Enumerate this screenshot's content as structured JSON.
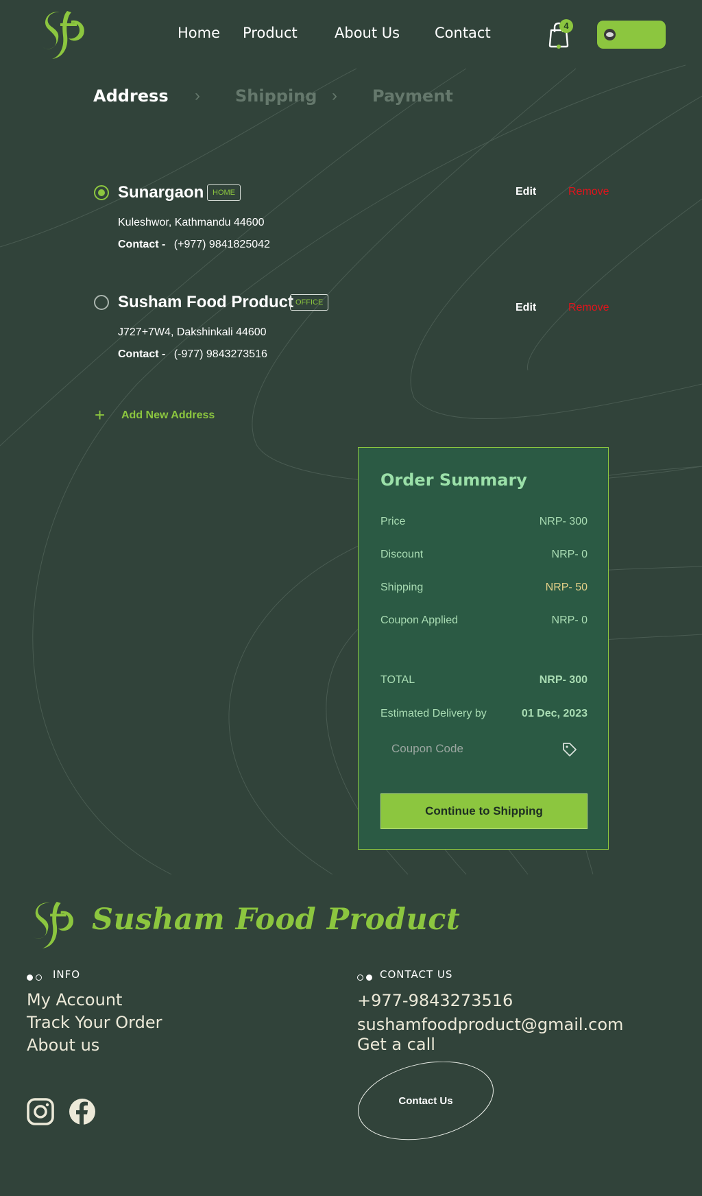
{
  "header": {
    "nav": [
      "Home",
      "Product",
      "About Us",
      "Contact"
    ],
    "cart_count": "4",
    "icons": {
      "logo": "sfp-monogram-logo",
      "cart": "shopping-bag-icon",
      "avatar": "user-avatar"
    }
  },
  "steps": {
    "address": "Address",
    "shipping": "Shipping",
    "payment": "Payment",
    "separator": "›"
  },
  "addresses": [
    {
      "name": "Sunargaon",
      "tag": "HOME",
      "line": "Kuleshwor, Kathmandu 44600",
      "contact_label": "Contact -",
      "phone": "(+977) 9841825042",
      "selected": true
    },
    {
      "name": "Susham Food Product",
      "tag": "OFFICE",
      "line": "J727+7W4, Dakshinkali 44600",
      "contact_label": "Contact -",
      "phone": "(-977) 9843273516",
      "selected": false
    }
  ],
  "actions": {
    "edit": "Edit",
    "remove": "Remove",
    "add_new": "Add New Address"
  },
  "summary": {
    "title": "Order Summary",
    "rows": [
      {
        "label": "Price",
        "value": "NRP- 300"
      },
      {
        "label": "Discount",
        "value": "NRP- 0"
      },
      {
        "label": "Shipping",
        "value": "NRP- 50"
      },
      {
        "label": "Coupon Applied",
        "value": "NRP- 0"
      }
    ],
    "total_label": "TOTAL",
    "total_value": "NRP- 300",
    "delivery_label": "Estimated Delivery by",
    "delivery_value": "01 Dec, 2023",
    "coupon_placeholder": "Coupon Code",
    "cta": "Continue to Shipping"
  },
  "footer": {
    "brand": "Susham Food Product",
    "info_heading": "INFO",
    "info_links": [
      "My Account",
      "Track Your Order",
      "About us"
    ],
    "contact_heading": "CONTACT US",
    "phone": "+977-9843273516",
    "email": "sushamfoodproduct@gmail.com",
    "call": "Get a call",
    "contact_button": "Contact Us",
    "social": [
      "instagram-icon",
      "facebook-icon"
    ]
  },
  "colors": {
    "background": "#31433a",
    "accent": "#8cc63f",
    "card": "#2b5a44",
    "remove": "#e0141c"
  }
}
